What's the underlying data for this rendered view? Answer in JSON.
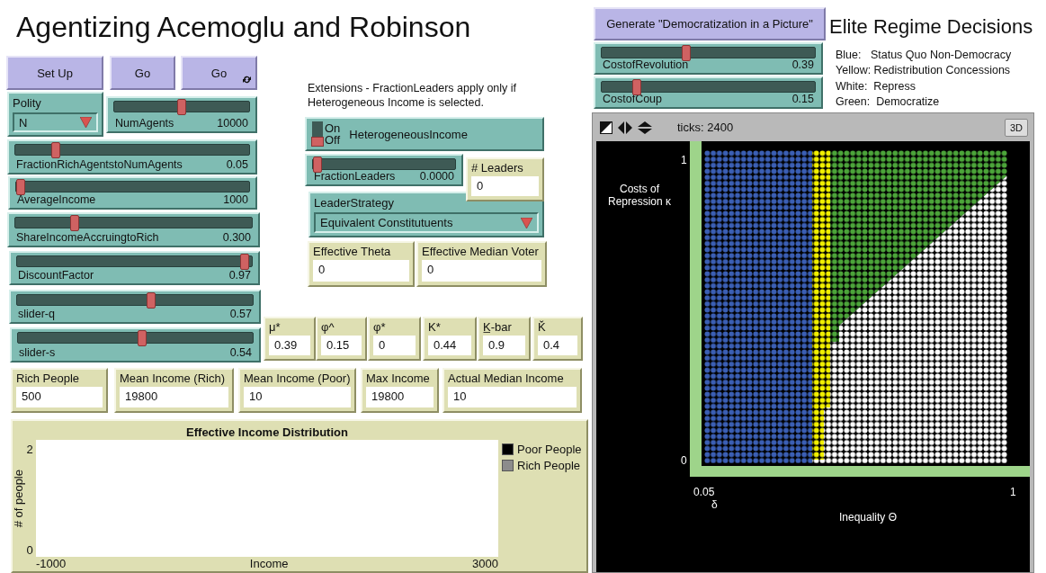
{
  "title": "Agentizing Acemoglu and Robinson",
  "note": "Extensions - FractionLeaders apply only if Heterogeneous Income is selected.",
  "buttons": [
    {
      "label": "Set Up",
      "forever": false
    },
    {
      "label": "Go",
      "forever": false
    },
    {
      "label": "Go",
      "forever": true
    },
    {
      "label": "Generate \"Democratization in a Picture\"",
      "forever": false
    }
  ],
  "choosers": [
    {
      "label": "Polity",
      "value": "N"
    },
    {
      "label": "LeaderStrategy",
      "value": "Equivalent Constitutuents"
    }
  ],
  "switches": [
    {
      "label": "HeterogeneousIncome",
      "on": false,
      "on_text": "On",
      "off_text": "Off"
    }
  ],
  "sliders": [
    {
      "label": "NumAgents",
      "value": "10000",
      "level": 0.5
    },
    {
      "label": "FractionRichAgentstoNumAgents",
      "value": "0.05",
      "level": 0.16
    },
    {
      "label": "AverageIncome",
      "value": "1000",
      "level": 0
    },
    {
      "label": "ShareIncomeAccruingtoRich",
      "value": "0.300",
      "level": 0.24
    },
    {
      "label": "DiscountFactor",
      "value": "0.97",
      "level": 0.99
    },
    {
      "label": "slider-q",
      "value": "0.57",
      "level": 0.57
    },
    {
      "label": "slider-s",
      "value": "0.54",
      "level": 0.53
    },
    {
      "label": "FractionLeaders",
      "value": "0.0000",
      "level": 0
    },
    {
      "label": "CostofRevolution",
      "value": "0.39",
      "level": 0.39
    },
    {
      "label": "CostofCoup",
      "value": "0.15",
      "level": 0.15
    }
  ],
  "monitors": [
    {
      "label": "# Leaders",
      "value": "0"
    },
    {
      "label": "Effective Theta",
      "value": "0"
    },
    {
      "label": "Effective Median Voter",
      "value": "0"
    },
    {
      "label": "μ*",
      "value": "0.39"
    },
    {
      "label": "φ^",
      "value": "0.15"
    },
    {
      "label": "φ*",
      "value": "0"
    },
    {
      "label": "K*",
      "value": "0.44"
    },
    {
      "label": "K̲-bar",
      "value": "0.9"
    },
    {
      "label": "Ǩ",
      "value": "0.4"
    },
    {
      "label": "Rich People",
      "value": "500"
    },
    {
      "label": "Mean Income (Rich)",
      "value": "19800"
    },
    {
      "label": "Mean Income (Poor)",
      "value": "10"
    },
    {
      "label": "Max Income",
      "value": "19800"
    },
    {
      "label": "Actual Median Income",
      "value": "10"
    }
  ],
  "plot": {
    "title": "Effective Income Distribution",
    "ylabel": "# of people",
    "xlabel": "Income",
    "y_max": "2",
    "y_min": "0",
    "x_min": "-1000",
    "x_max": "3000",
    "legend": [
      {
        "label": "Poor People",
        "color": "#000000"
      },
      {
        "label": "Rich People",
        "color": "#8c8c8c"
      }
    ]
  },
  "regime_title": "Elite Regime Decisions",
  "regime_legend": [
    "Blue:   Status Quo Non-Democracy",
    "Yellow: Redistribution Concessions",
    "White:  Repress",
    "Green:  Democratize"
  ],
  "view": {
    "ticks": "ticks: 2400",
    "mode_button": "3D",
    "y_max": "1",
    "y_min": "0",
    "x_min": "0.05",
    "x_min_sub": "δ",
    "x_max": "1",
    "xlabel": "Inequality Θ",
    "ylabel": "Costs of Repression κ"
  }
}
